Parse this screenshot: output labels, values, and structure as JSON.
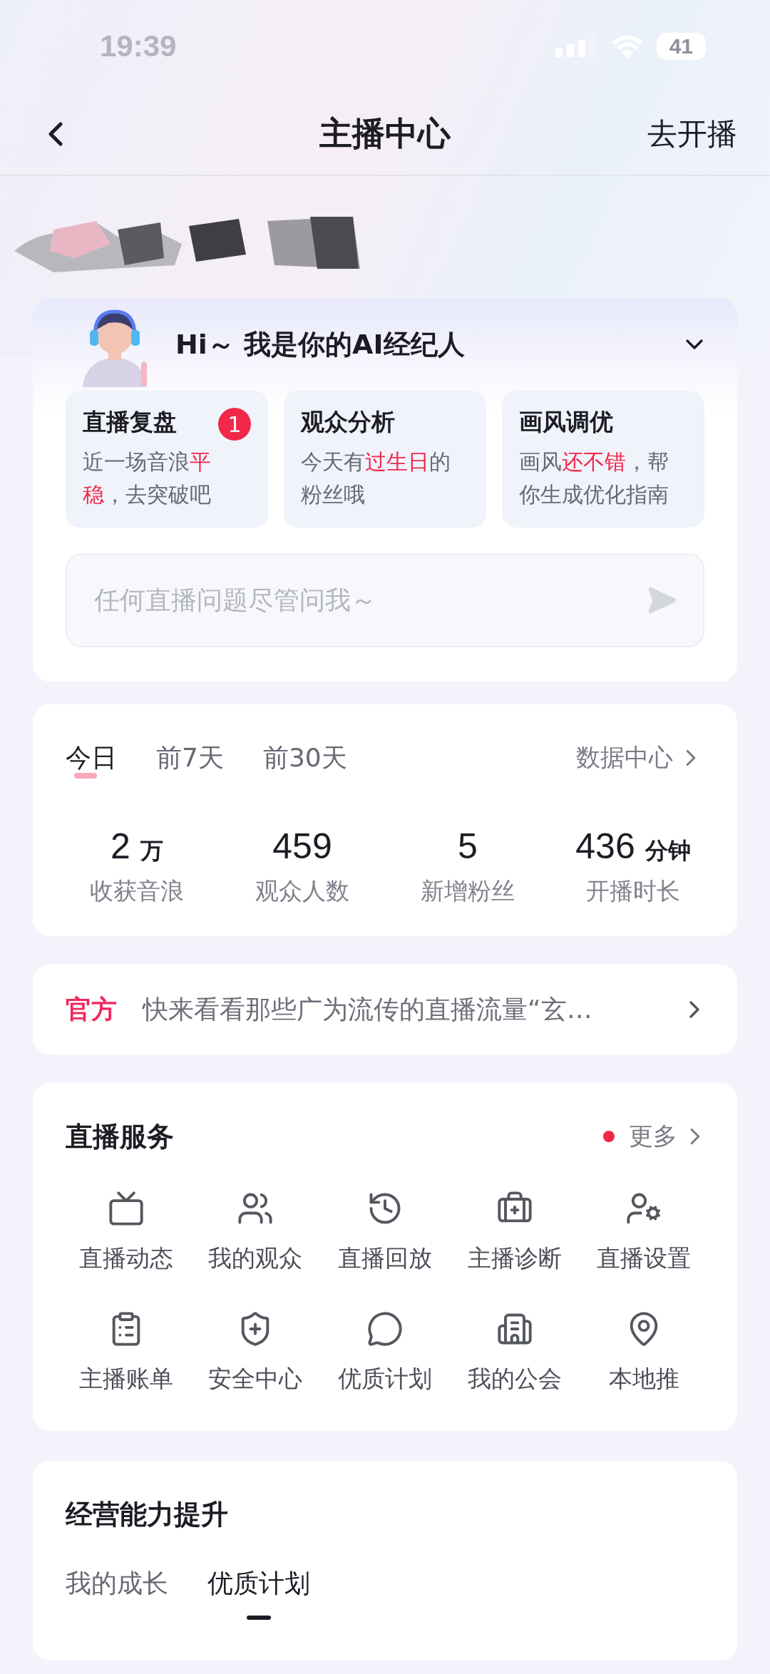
{
  "status_bar": {
    "time": "19:39",
    "battery": "41"
  },
  "nav": {
    "title": "主播中心",
    "action": "去开播"
  },
  "ai_assistant": {
    "greeting": "Hi～ 我是你的AI经纪人",
    "cards": [
      {
        "title": "直播复盘",
        "badge": "1",
        "text": "近一场音浪**平稳**，去突破吧"
      },
      {
        "title": "观众分析",
        "text": "今天有**过生日**的粉丝哦"
      },
      {
        "title": "画风调优",
        "text": "画风**还不错**，帮你生成优化指南"
      }
    ],
    "input": {
      "placeholder": "任何直播问题尽管问我～"
    }
  },
  "stats": {
    "tabs": [
      {
        "label": "今日",
        "selected": true
      },
      {
        "label": "前7天",
        "selected": false
      },
      {
        "label": "前30天",
        "selected": false
      }
    ],
    "link": "数据中心",
    "metrics": [
      {
        "value": "2",
        "unit": "万",
        "label": "收获音浪"
      },
      {
        "value": "459",
        "label": "观众人数"
      },
      {
        "value": "5",
        "label": "新增粉丝"
      },
      {
        "value": "436",
        "unit": "分钟",
        "label": "开播时长"
      }
    ]
  },
  "notice": {
    "tag": "官方",
    "text": "快来看看那些广为流传的直播流量“玄…"
  },
  "services": {
    "title": "直播服务",
    "more": "更多",
    "more_dot": true,
    "items": [
      {
        "label": "直播动态"
      },
      {
        "label": "我的观众"
      },
      {
        "label": "直播回放"
      },
      {
        "label": "主播诊断"
      },
      {
        "label": "直播设置"
      },
      {
        "label": "主播账单"
      },
      {
        "label": "安全中心"
      },
      {
        "label": "优质计划"
      },
      {
        "label": "我的公会"
      },
      {
        "label": "本地推"
      }
    ]
  },
  "growth": {
    "title": "经营能力提升",
    "tabs": [
      {
        "label": "我的成长",
        "selected": false
      },
      {
        "label": "优质计划",
        "selected": true
      }
    ]
  }
}
